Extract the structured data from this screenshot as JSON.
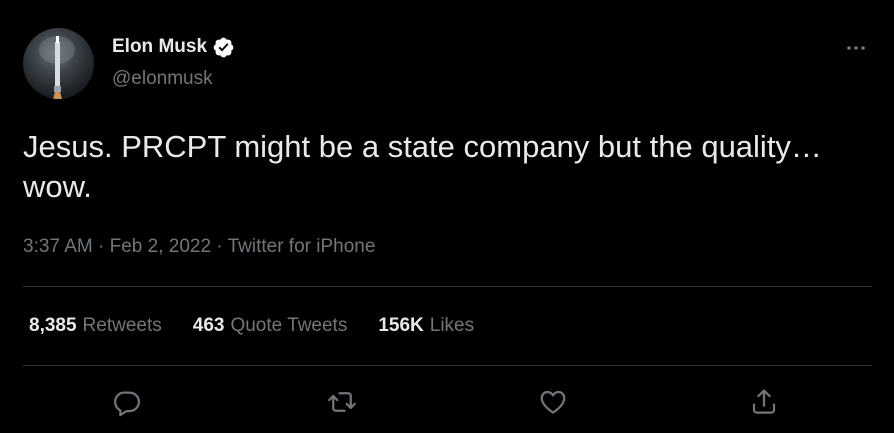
{
  "author": {
    "display_name": "Elon Musk",
    "handle": "@elonmusk",
    "verified": true,
    "avatar_icon": "rocket-avatar"
  },
  "tweet": {
    "text": "Jesus. PRCPT might be a state company but the quality… wow.",
    "time": "3:37 AM",
    "date": "Feb 2, 2022",
    "separator": "·",
    "source": "Twitter for iPhone"
  },
  "stats": {
    "retweets_count": "8,385",
    "retweets_label": "Retweets",
    "quote_count": "463",
    "quote_label": "Quote Tweets",
    "likes_count": "156K",
    "likes_label": "Likes"
  },
  "actions": {
    "reply_icon": "reply-icon",
    "retweet_icon": "retweet-icon",
    "like_icon": "heart-icon",
    "share_icon": "share-icon"
  },
  "colors": {
    "background": "#000000",
    "primary_text": "#e7e9ea",
    "secondary_text": "#71767b",
    "divider": "#2f3336",
    "verified_badge": "#ffffff"
  }
}
